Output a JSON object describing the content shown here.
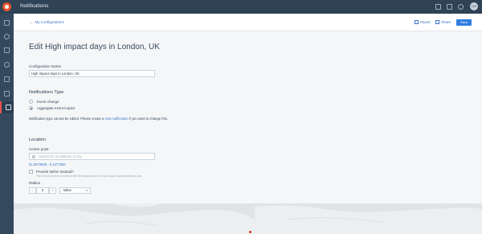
{
  "app": {
    "title": "Notifications",
    "avatar_initials": "GA"
  },
  "topbar_icons": [
    "grid-icon",
    "bookmark-icon",
    "help-icon"
  ],
  "sidebar": {
    "items": [
      "menu-icon",
      "search-icon",
      "calendar-icon",
      "compass-icon",
      "pulse-icon",
      "document-icon",
      "notifications-icon"
    ],
    "active": "notifications-icon",
    "accent_color": "#e8544e"
  },
  "header": {
    "back_label": "My Configurations",
    "pause_label": "Pause",
    "share_label": "Share",
    "save_label": "Save"
  },
  "page_title": "Edit High impact days in London, UK",
  "form": {
    "config_name_label": "Configuration Name",
    "config_name_value": "High impact days in London, UK",
    "type_section": "Notifications Type",
    "type_options": [
      "Event change",
      "Aggregate event impact"
    ],
    "type_selected": "Aggregate event impact",
    "type_note_before": "Notification type cannot be edited. Please create a",
    "type_note_link": "new notification",
    "type_note_after": "if you want to change this.",
    "location_section": "Location",
    "center_point_label": "Center point",
    "search_placeholder": "Search for an address or city",
    "coordinates": "51.5073509, -0.1277583",
    "latlon_label": "Provide lat/lon instead?",
    "latlon_hint": "Pick the box if you're not able to find the location above or if you have a specific lat/lon to use.",
    "radius_label": "Radius",
    "radius_minus": "−",
    "radius_value": "5",
    "radius_plus": "+",
    "radius_unit": "Miles"
  },
  "colors": {
    "topbar": "#2f4256",
    "sidebar": "#34495e",
    "link": "#3c72c9",
    "primary_button": "#2f7ee0"
  }
}
